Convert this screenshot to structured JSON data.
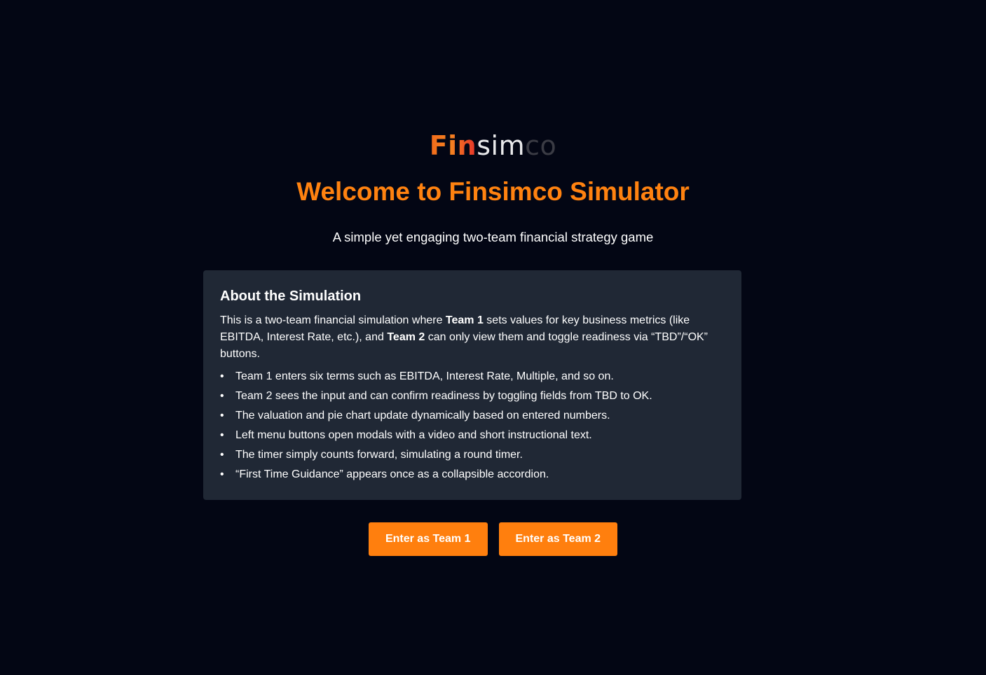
{
  "brand": {
    "logo_part1": "Fin",
    "logo_part2": "sim",
    "logo_part3": "co"
  },
  "hero": {
    "title": "Welcome to Finsimco Simulator",
    "subtitle": "A simple yet engaging two-team financial strategy game"
  },
  "about": {
    "heading": "About the Simulation",
    "desc_part1": "This is a two-team financial simulation where ",
    "desc_team1": "Team 1",
    "desc_part2": " sets values for key business metrics (like EBITDA, Interest Rate, etc.), and ",
    "desc_team2": "Team 2",
    "desc_part3": " can only view them and toggle readiness via “TBD”/“OK” buttons.",
    "bullets": [
      "Team 1 enters six terms such as EBITDA, Interest Rate, Multiple, and so on.",
      "Team 2 sees the input and can confirm readiness by toggling fields from TBD to OK.",
      "The valuation and pie chart update dynamically based on entered numbers.",
      "Left menu buttons open modals with a video and short instructional text.",
      "The timer simply counts forward, simulating a round timer.",
      "“First Time Guidance” appears once as a collapsible accordion."
    ]
  },
  "actions": {
    "team1_label": "Enter as Team 1",
    "team2_label": "Enter as Team 2"
  },
  "colors": {
    "background": "#030614",
    "accent": "#ff8210",
    "card": "#202835",
    "button": "#ff7f0e"
  }
}
